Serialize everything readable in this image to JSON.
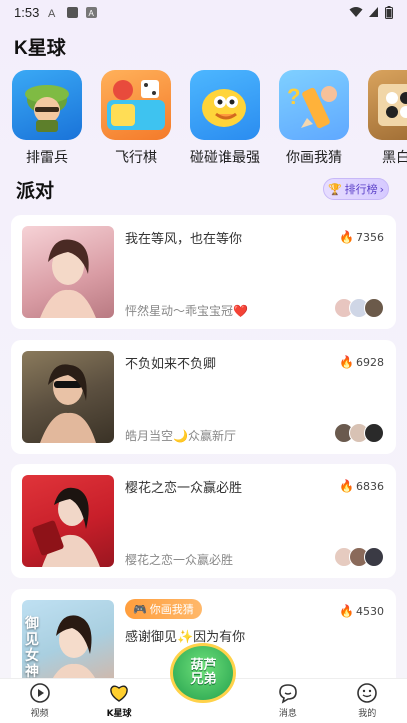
{
  "status": {
    "time": "1:53"
  },
  "star": {
    "title": "K星球"
  },
  "games": [
    {
      "label": "排雷兵",
      "icon": "soldier-icon"
    },
    {
      "label": "飞行棋",
      "icon": "board-game-icon"
    },
    {
      "label": "碰碰谁最强",
      "icon": "bird-icon"
    },
    {
      "label": "你画我猜",
      "icon": "pencil-icon"
    },
    {
      "label": "黑白棋",
      "icon": "chess-board-icon"
    }
  ],
  "party": {
    "title": "派对",
    "rank_label": "排行榜",
    "cards": [
      {
        "title": "我在等风，也在等你",
        "sub": "怦然星动～乖宝宝冠❤️",
        "hot": "7356"
      },
      {
        "title": "不负如来不负卿",
        "sub": "皓月当空🌙众赢新厅",
        "hot": "6928"
      },
      {
        "title": "樱花之恋一众赢必胜",
        "sub": "樱花之恋一众赢必胜",
        "hot": "6836"
      },
      {
        "title": "感谢御见✨因为有你",
        "sub": "",
        "hot": "4530",
        "tag": "你画我猜",
        "photo_text": "御见女神"
      }
    ]
  },
  "nav": {
    "video": "视频",
    "star": "K星球",
    "center": "葫芦\n兄弟",
    "message": "消息",
    "me": "我的"
  }
}
